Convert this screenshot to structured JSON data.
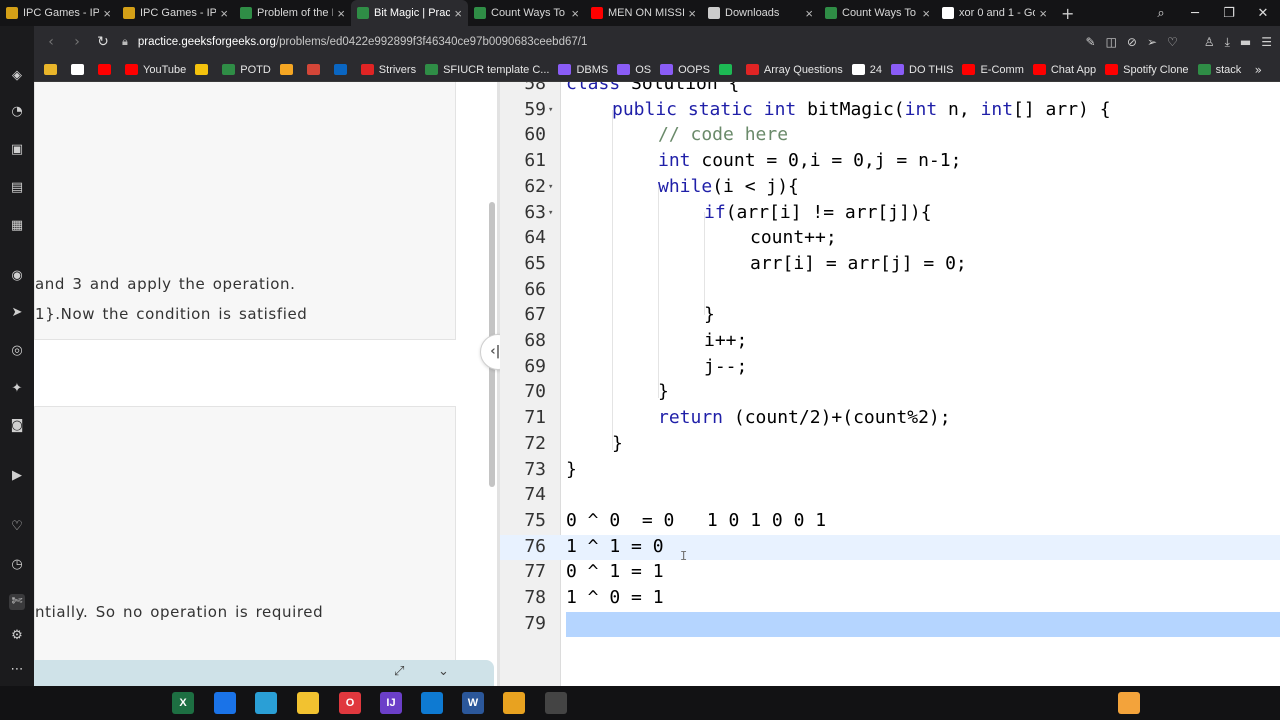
{
  "browser": {
    "tabs": [
      {
        "title": "IPC Games - IPC",
        "favicon": "ipc-icon",
        "color": "#d4a017",
        "active": false
      },
      {
        "title": "IPC Games - IPC",
        "favicon": "ipc-icon",
        "color": "#d4a017",
        "active": false
      },
      {
        "title": "Problem of the D",
        "favicon": "gfg-icon",
        "color": "#2f8d46",
        "active": false
      },
      {
        "title": "Bit Magic | Pract",
        "favicon": "gfg-icon",
        "color": "#2f8d46",
        "active": true
      },
      {
        "title": "Count Ways To B",
        "favicon": "gfg-icon",
        "color": "#2f8d46",
        "active": false
      },
      {
        "title": "MEN ON MISSIO",
        "favicon": "youtube-icon",
        "color": "#ff0000",
        "active": false
      },
      {
        "title": "Downloads",
        "favicon": "download-icon",
        "color": "#cccccc",
        "active": false
      },
      {
        "title": "Count Ways To B",
        "favicon": "gfg-icon",
        "color": "#2f8d46",
        "active": false
      },
      {
        "title": "xor 0 and 1 - Go",
        "favicon": "google-icon",
        "color": "#ffffff",
        "active": false
      }
    ],
    "url_host": "practice.geeksforgeeks.org",
    "url_path": "/problems/ed0422e992899f3f46340ce97b0090683ceebd67/1",
    "bookmarks": [
      {
        "label": "",
        "icon": "chrome-icon",
        "color": "#e9b52a"
      },
      {
        "label": "",
        "icon": "github-icon",
        "color": "#ffffff"
      },
      {
        "label": "",
        "icon": "youtube-icon",
        "color": "#ff0000"
      },
      {
        "label": "YouTube",
        "icon": "youtube-icon",
        "color": "#ff0000"
      },
      {
        "label": "",
        "icon": "keep-icon",
        "color": "#f4c20d"
      },
      {
        "label": "POTD",
        "icon": "gfg-icon",
        "color": "#2f8d46"
      },
      {
        "label": "",
        "icon": "chart-icon",
        "color": "#f5a623"
      },
      {
        "label": "",
        "icon": "gmail-icon",
        "color": "#d44638"
      },
      {
        "label": "",
        "icon": "linkedin-icon",
        "color": "#0a66c2"
      },
      {
        "label": "Strivers",
        "icon": "tuf-icon",
        "color": "#e02424"
      },
      {
        "label": "SFIUCR template C...",
        "icon": "leaf-icon",
        "color": "#2f8d46"
      },
      {
        "label": "DBMS",
        "icon": "folder-icon",
        "color": "#8a5cf6"
      },
      {
        "label": "OS",
        "icon": "folder-icon",
        "color": "#8a5cf6"
      },
      {
        "label": "OOPS",
        "icon": "folder-icon",
        "color": "#8a5cf6"
      },
      {
        "label": "",
        "icon": "spotify-icon",
        "color": "#1db954"
      },
      {
        "label": "Array Questions",
        "icon": "tuf-icon",
        "color": "#e02424"
      },
      {
        "label": "24",
        "icon": "doc-icon",
        "color": "#ffffff"
      },
      {
        "label": "DO THIS",
        "icon": "folder-icon",
        "color": "#8a5cf6"
      },
      {
        "label": "E-Comm",
        "icon": "youtube-icon",
        "color": "#ff0000"
      },
      {
        "label": "Chat App",
        "icon": "youtube-icon",
        "color": "#ff0000"
      },
      {
        "label": "Spotify Clone",
        "icon": "youtube-icon",
        "color": "#ff0000"
      },
      {
        "label": "stack",
        "icon": "gfg-icon",
        "color": "#2f8d46"
      }
    ]
  },
  "problem": {
    "line1": "and 3 and apply the operation.",
    "line2": "1}.Now the condition is satisfied",
    "line3": "ntially. So no operation is required"
  },
  "editor": {
    "lines": [
      {
        "n": "58",
        "text": "class Solution {",
        "indent": 0
      },
      {
        "n": "59",
        "text": "public static int bitMagic(int n, int[] arr) {",
        "indent": 1,
        "fold": true
      },
      {
        "n": "60",
        "text": "// code here",
        "indent": 2,
        "comment": true
      },
      {
        "n": "61",
        "text": "int count = 0,i = 0,j = n-1;",
        "indent": 2
      },
      {
        "n": "62",
        "text": "while(i < j){",
        "indent": 2,
        "fold": true
      },
      {
        "n": "63",
        "text": "if(arr[i] != arr[j]){",
        "indent": 3,
        "fold": true
      },
      {
        "n": "64",
        "text": "count++;",
        "indent": 4
      },
      {
        "n": "65",
        "text": "arr[i] = arr[j] = 0;",
        "indent": 4
      },
      {
        "n": "66",
        "text": "",
        "indent": 0
      },
      {
        "n": "67",
        "text": "}",
        "indent": 3
      },
      {
        "n": "68",
        "text": "i++;",
        "indent": 3
      },
      {
        "n": "69",
        "text": "j--;",
        "indent": 3
      },
      {
        "n": "70",
        "text": "}",
        "indent": 2
      },
      {
        "n": "71",
        "text": "return (count/2)+(count%2);",
        "indent": 2
      },
      {
        "n": "72",
        "text": "}",
        "indent": 1
      },
      {
        "n": "73",
        "text": "}",
        "indent": 0
      },
      {
        "n": "74",
        "text": "",
        "indent": 0
      },
      {
        "n": "75",
        "text": "0 ^ 0  = 0   1 0 1 0 0 1",
        "indent": 0
      },
      {
        "n": "76",
        "text": "1 ^ 1 = 0",
        "indent": 0
      },
      {
        "n": "77",
        "text": "0 ^ 1 = 1",
        "indent": 0
      },
      {
        "n": "78",
        "text": "1 ^ 0 = 1",
        "indent": 0
      },
      {
        "n": "79",
        "text": "",
        "indent": 0
      }
    ]
  },
  "taskbar": {
    "apps": [
      {
        "name": "windows-start-icon",
        "label": "",
        "color": "#121214"
      },
      {
        "name": "search-icon",
        "label": "",
        "color": "#121214"
      },
      {
        "name": "taskview-icon",
        "label": "",
        "color": "#121214"
      },
      {
        "name": "excel-icon",
        "label": "X",
        "color": "#1d6f42"
      },
      {
        "name": "mail-icon",
        "label": "",
        "color": "#1a73e8"
      },
      {
        "name": "edge-icon",
        "label": "",
        "color": "#2a9fd6"
      },
      {
        "name": "file-explorer-icon",
        "label": "",
        "color": "#f2c230"
      },
      {
        "name": "opera-icon",
        "label": "O",
        "color": "#e0383e"
      },
      {
        "name": "intellij-icon",
        "label": "IJ",
        "color": "#6b3fc8"
      },
      {
        "name": "vscode-icon",
        "label": "",
        "color": "#0e7ad2"
      },
      {
        "name": "word-icon",
        "label": "W",
        "color": "#2b579a"
      },
      {
        "name": "sublime-icon",
        "label": "",
        "color": "#e8a220"
      },
      {
        "name": "chrome-icon",
        "label": "",
        "color": "#444444"
      },
      {
        "name": "weather-icon",
        "label": "",
        "color": "#f3a33b"
      }
    ]
  }
}
